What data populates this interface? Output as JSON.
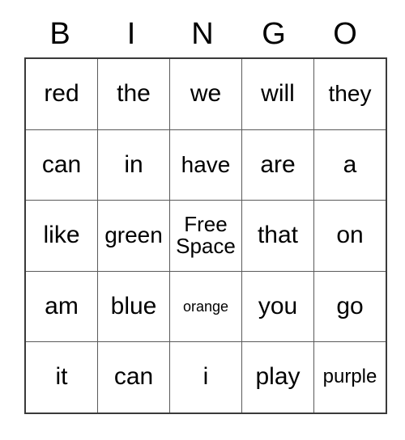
{
  "card": {
    "headers": [
      "B",
      "I",
      "N",
      "G",
      "O"
    ],
    "rows": [
      [
        {
          "text": "red",
          "size": "s-30"
        },
        {
          "text": "the",
          "size": "s-30"
        },
        {
          "text": "we",
          "size": "s-30"
        },
        {
          "text": "will",
          "size": "s-30"
        },
        {
          "text": "they",
          "size": "s-28"
        }
      ],
      [
        {
          "text": "can",
          "size": "s-30"
        },
        {
          "text": "in",
          "size": "s-30"
        },
        {
          "text": "have",
          "size": "s-28"
        },
        {
          "text": "are",
          "size": "s-30"
        },
        {
          "text": "a",
          "size": "s-30"
        }
      ],
      [
        {
          "text": "like",
          "size": "s-30"
        },
        {
          "text": "green",
          "size": "s-28"
        },
        {
          "text": "Free Space",
          "size": "two-line"
        },
        {
          "text": "that",
          "size": "s-30"
        },
        {
          "text": "on",
          "size": "s-30"
        }
      ],
      [
        {
          "text": "am",
          "size": "s-30"
        },
        {
          "text": "blue",
          "size": "s-30"
        },
        {
          "text": "orange",
          "size": "s-18"
        },
        {
          "text": "you",
          "size": "s-30"
        },
        {
          "text": "go",
          "size": "s-30"
        }
      ],
      [
        {
          "text": "it",
          "size": "s-30"
        },
        {
          "text": "can",
          "size": "s-30"
        },
        {
          "text": "i",
          "size": "s-30"
        },
        {
          "text": "play",
          "size": "s-30"
        },
        {
          "text": "purple",
          "size": "s-24"
        }
      ]
    ],
    "colors": {
      "text": "#000000",
      "background": "#ffffff",
      "grid_line": "#5a5a5a",
      "outer_border": "#3a3a3a"
    }
  }
}
